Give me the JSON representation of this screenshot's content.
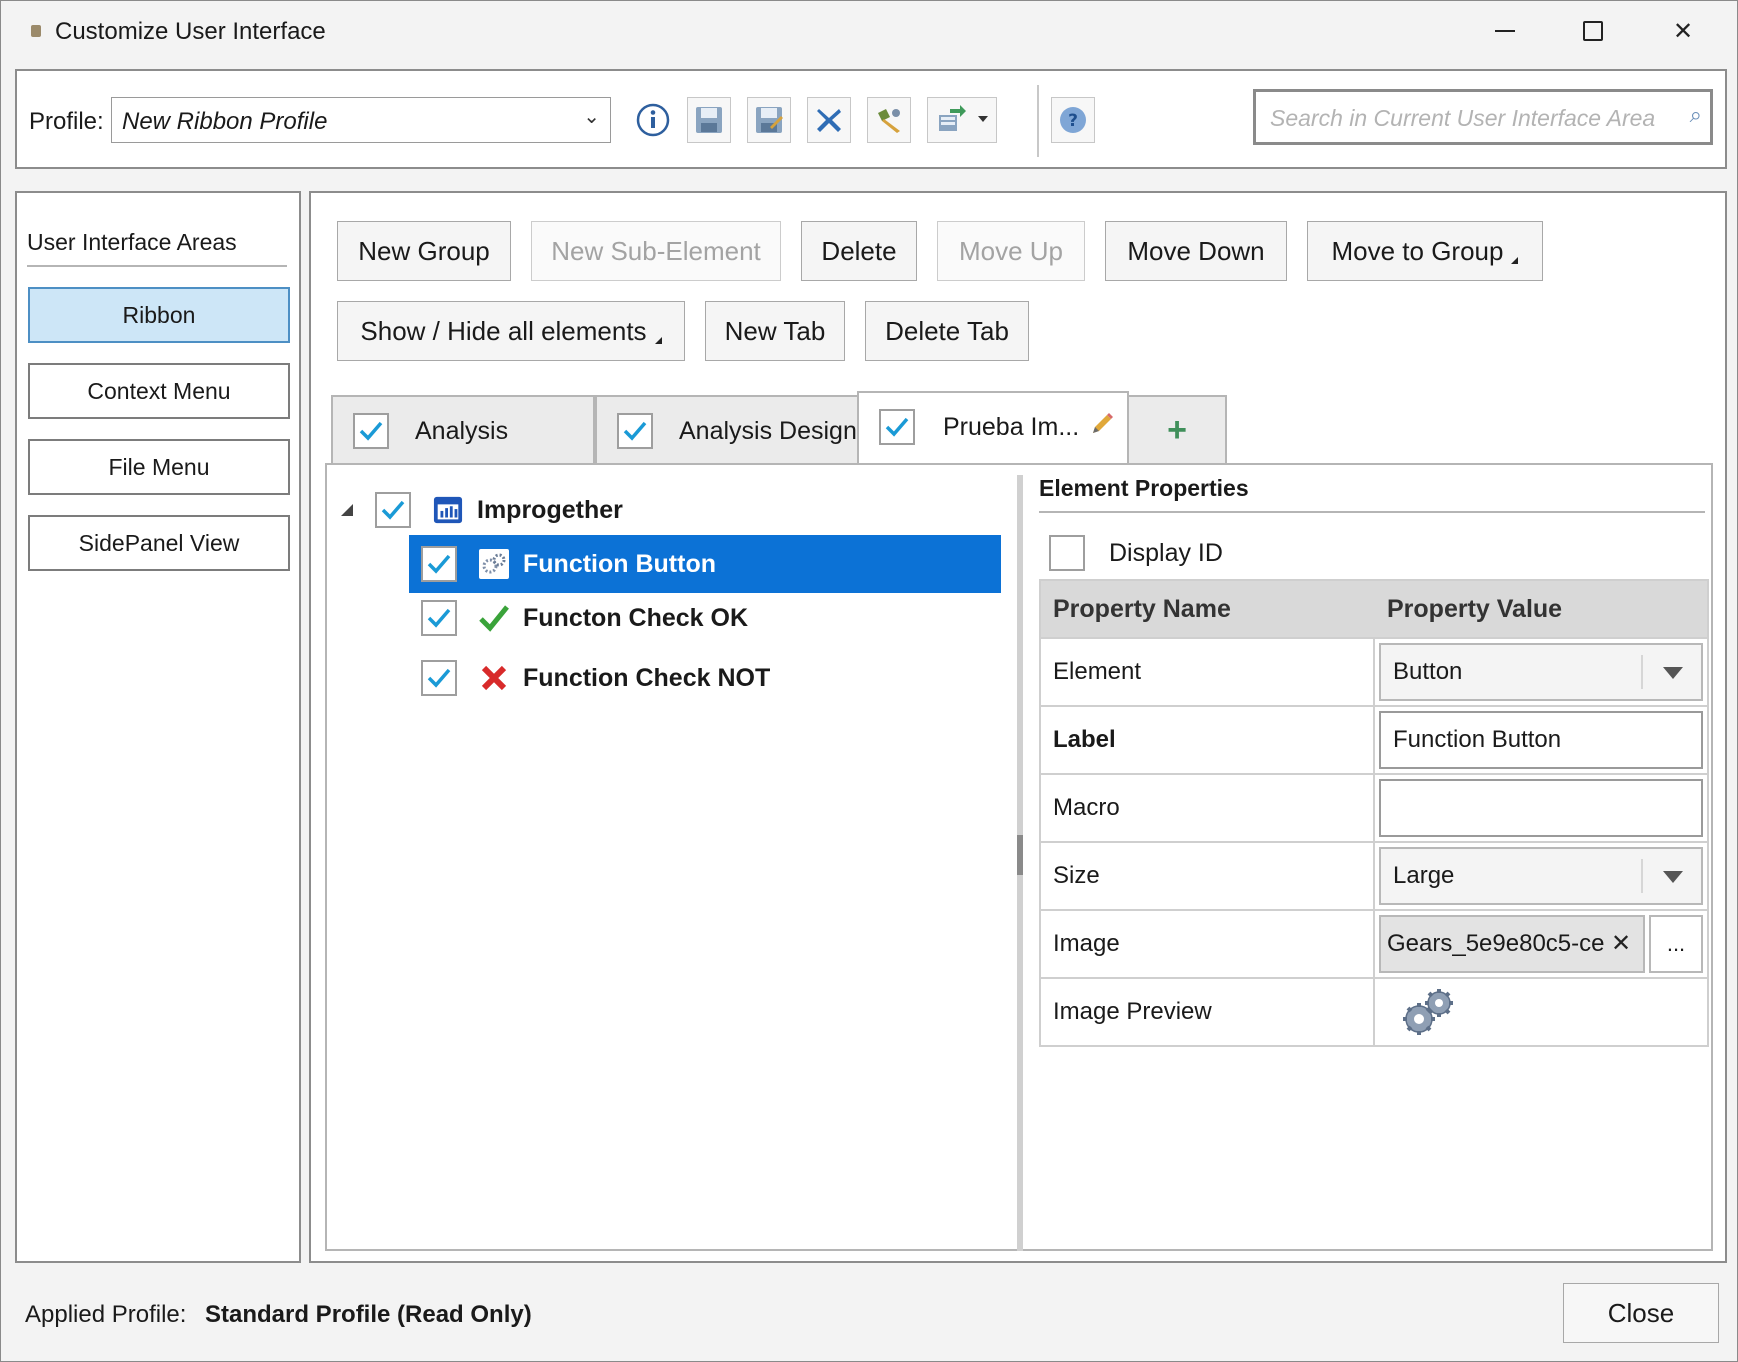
{
  "window": {
    "title": "Customize User Interface",
    "minimize_glyph": "",
    "close_glyph": "✕"
  },
  "toolbar": {
    "profile_label": "Profile:",
    "profile_value": "New Ribbon Profile",
    "search_placeholder": "Search in Current User Interface Area",
    "icons": [
      "info-icon",
      "save-icon",
      "save-as-icon",
      "delete-profile-icon",
      "edit-profile-icon",
      "import-export-icon",
      "help-icon"
    ]
  },
  "sidebar": {
    "title": "User Interface Areas",
    "items": [
      {
        "label": "Ribbon",
        "active": true
      },
      {
        "label": "Context Menu",
        "active": false
      },
      {
        "label": "File Menu",
        "active": false
      },
      {
        "label": "SidePanel View",
        "active": false
      }
    ]
  },
  "actions": {
    "new_group": "New Group",
    "new_sub_element": "New Sub-Element",
    "delete": "Delete",
    "move_up": "Move Up",
    "move_down": "Move Down",
    "move_to_group": "Move to Group",
    "show_hide_all": "Show / Hide all elements",
    "new_tab": "New Tab",
    "delete_tab": "Delete Tab"
  },
  "tabs": [
    {
      "label": "Analysis",
      "checked": true,
      "active": false
    },
    {
      "label": "Analysis Design",
      "checked": true,
      "active": false
    },
    {
      "label": "Prueba Im...",
      "checked": true,
      "active": true
    }
  ],
  "tree": {
    "group": {
      "label": "Improgether",
      "checked": true,
      "expanded": true
    },
    "items": [
      {
        "label": "Function Button",
        "checked": true,
        "icon": "gears-icon",
        "selected": true
      },
      {
        "label": "Functon Check OK",
        "checked": true,
        "icon": "green-check-icon",
        "selected": false
      },
      {
        "label": "Function Check NOT",
        "checked": true,
        "icon": "red-x-icon",
        "selected": false
      }
    ]
  },
  "properties": {
    "title": "Element Properties",
    "display_id_label": "Display ID",
    "display_id_checked": false,
    "col_name": "Property Name",
    "col_value": "Property Value",
    "rows": {
      "element": {
        "name": "Element",
        "value": "Button"
      },
      "label": {
        "name": "Label",
        "value": "Function Button"
      },
      "macro": {
        "name": "Macro",
        "value": ""
      },
      "size": {
        "name": "Size",
        "value": "Large"
      },
      "image": {
        "name": "Image",
        "value": "Gears_5e9e80c5-ce",
        "browse": "..."
      },
      "image_preview": {
        "name": "Image Preview"
      }
    }
  },
  "footer": {
    "applied_label": "Applied Profile:",
    "applied_value": "Standard Profile (Read Only)",
    "close": "Close"
  },
  "colors": {
    "selection": "#0c72d6",
    "checkmark": "#1a9ad6",
    "active_area": "#cde6f7"
  }
}
